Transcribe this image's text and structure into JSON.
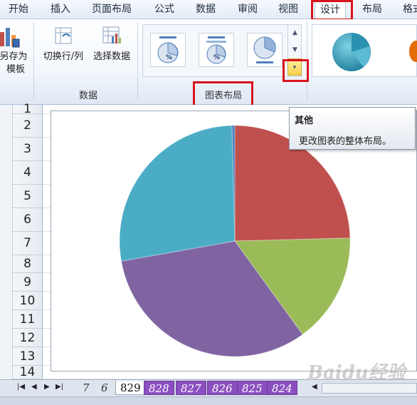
{
  "menu": {
    "tabs": [
      {
        "label": "开始"
      },
      {
        "label": "插入"
      },
      {
        "label": "页面布局"
      },
      {
        "label": "公式"
      },
      {
        "label": "数据"
      },
      {
        "label": "审阅"
      },
      {
        "label": "视图"
      },
      {
        "label": "设计",
        "active": true
      },
      {
        "label": "布局"
      },
      {
        "label": "格式"
      }
    ]
  },
  "ribbon": {
    "save_as_template_1": "另存为",
    "save_as_template_2": "模板",
    "switch_row_col": "切换行/列",
    "select_data": "选择数据",
    "group_data": "数据",
    "group_chart_layouts": "图表布局",
    "gallery_percent": "%",
    "style_preview_icon": "pie-3d-icon"
  },
  "tooltip": {
    "title": "其他",
    "description": "更改图表的整体布局。"
  },
  "sheet": {
    "rows": [
      "1",
      "2",
      "3",
      "4",
      "5",
      "6",
      "7",
      "8",
      "9",
      "10",
      "11",
      "12",
      "13",
      "14"
    ]
  },
  "chart_data": {
    "type": "pie",
    "slices": [
      {
        "value": 24.6,
        "color": "#c0504d"
      },
      {
        "value": 15.4,
        "color": "#9bbb59"
      },
      {
        "value": 32.2,
        "color": "#8064a2"
      },
      {
        "value": 27.4,
        "color": "#4bacc6"
      },
      {
        "value": 0.4,
        "color": "#4f81bd"
      }
    ]
  },
  "sheet_tabs": {
    "tabs": [
      {
        "label": "7",
        "style": "plain"
      },
      {
        "label": "6",
        "style": "plain"
      },
      {
        "label": "829",
        "style": "active"
      },
      {
        "label": "828",
        "style": "purple"
      },
      {
        "label": "827",
        "style": "purple"
      },
      {
        "label": "826",
        "style": "purple"
      },
      {
        "label": "825",
        "style": "purple"
      },
      {
        "label": "824",
        "style": "purple"
      }
    ]
  },
  "watermark": "Baidu经验"
}
